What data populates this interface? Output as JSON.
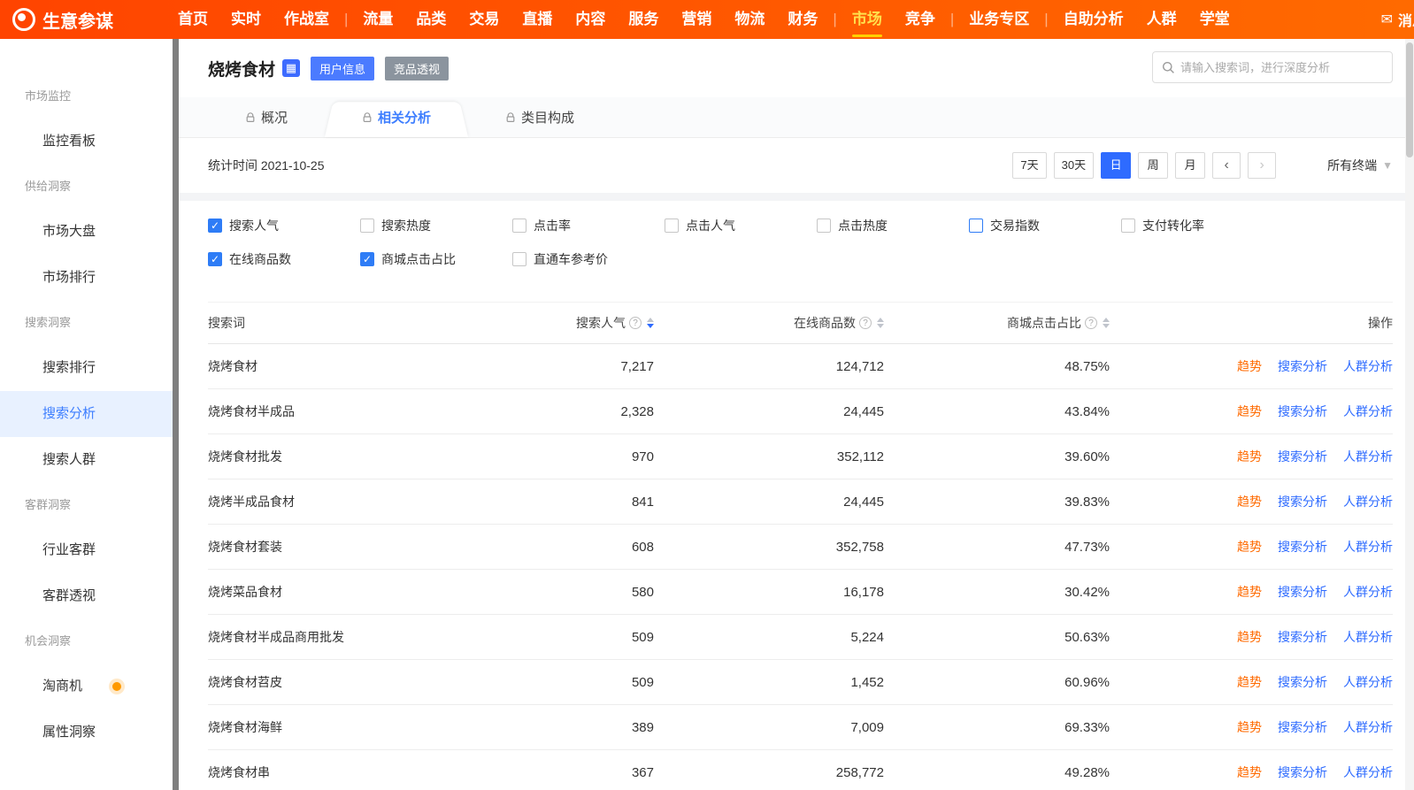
{
  "topnav": {
    "logo": "生意参谋",
    "groups": [
      [
        "首页",
        "实时",
        "作战室"
      ],
      [
        "流量",
        "品类",
        "交易",
        "直播",
        "内容",
        "服务",
        "营销",
        "物流",
        "财务"
      ],
      [
        "市场",
        "竞争"
      ],
      [
        "业务专区"
      ],
      [
        "自助分析",
        "人群",
        "学堂"
      ]
    ],
    "active": "市场",
    "message_label": "消息"
  },
  "sidebar": {
    "sections": [
      {
        "title": "市场监控",
        "items": [
          {
            "label": "监控看板"
          }
        ]
      },
      {
        "title": "供给洞察",
        "items": [
          {
            "label": "市场大盘"
          },
          {
            "label": "市场排行"
          }
        ]
      },
      {
        "title": "搜索洞察",
        "items": [
          {
            "label": "搜索排行"
          },
          {
            "label": "搜索分析",
            "active": true
          },
          {
            "label": "搜索人群"
          }
        ]
      },
      {
        "title": "客群洞察",
        "items": [
          {
            "label": "行业客群"
          },
          {
            "label": "客群透视"
          }
        ]
      },
      {
        "title": "机会洞察",
        "items": [
          {
            "label": "淘商机",
            "badge": true
          },
          {
            "label": "属性洞察"
          }
        ]
      }
    ]
  },
  "header": {
    "title": "烧烤食材",
    "title_icon": "▦",
    "buttons": [
      {
        "label": "用户信息",
        "style": "blue"
      },
      {
        "label": "竞品透视",
        "style": "gray"
      }
    ],
    "search_placeholder": "请输入搜索词，进行深度分析"
  },
  "tabs": [
    {
      "label": "概况",
      "active": false
    },
    {
      "label": "相关分析",
      "active": true
    },
    {
      "label": "类目构成",
      "active": false
    }
  ],
  "toolbar": {
    "stat_time": "统计时间 2021-10-25",
    "range_buttons": [
      "7天",
      "30天",
      "日",
      "周",
      "月"
    ],
    "active_range": "日",
    "prev": "‹",
    "next": "›",
    "terminal": "所有终端"
  },
  "filters": {
    "row1": [
      {
        "label": "搜索人气",
        "checked": true
      },
      {
        "label": "搜索热度",
        "checked": false
      },
      {
        "label": "点击率",
        "checked": false
      },
      {
        "label": "点击人气",
        "checked": false
      },
      {
        "label": "点击热度",
        "checked": false
      },
      {
        "label": "交易指数",
        "checked": false,
        "focus": true
      },
      {
        "label": "支付转化率",
        "checked": false
      }
    ],
    "row2": [
      {
        "label": "在线商品数",
        "checked": true
      },
      {
        "label": "商城点击占比",
        "checked": true
      },
      {
        "label": "直通车参考价",
        "checked": false
      }
    ]
  },
  "table": {
    "columns": [
      "搜索词",
      "搜索人气",
      "在线商品数",
      "商城点击占比",
      "操作"
    ],
    "actions": [
      "趋势",
      "搜索分析",
      "人群分析"
    ],
    "rows": [
      {
        "keyword": "烧烤食材",
        "search_popularity": "7,217",
        "online_products": "124,712",
        "mall_click_ratio": "48.75%"
      },
      {
        "keyword": "烧烤食材半成品",
        "search_popularity": "2,328",
        "online_products": "24,445",
        "mall_click_ratio": "43.84%"
      },
      {
        "keyword": "烧烤食材批发",
        "search_popularity": "970",
        "online_products": "352,112",
        "mall_click_ratio": "39.60%"
      },
      {
        "keyword": "烧烤半成品食材",
        "search_popularity": "841",
        "online_products": "24,445",
        "mall_click_ratio": "39.83%"
      },
      {
        "keyword": "烧烤食材套装",
        "search_popularity": "608",
        "online_products": "352,758",
        "mall_click_ratio": "47.73%"
      },
      {
        "keyword": "烧烤菜品食材",
        "search_popularity": "580",
        "online_products": "16,178",
        "mall_click_ratio": "30.42%"
      },
      {
        "keyword": "烧烤食材半成品商用批发",
        "search_popularity": "509",
        "online_products": "5,224",
        "mall_click_ratio": "50.63%"
      },
      {
        "keyword": "烧烤食材苕皮",
        "search_popularity": "509",
        "online_products": "1,452",
        "mall_click_ratio": "60.96%"
      },
      {
        "keyword": "烧烤食材海鲜",
        "search_popularity": "389",
        "online_products": "7,009",
        "mall_click_ratio": "69.33%"
      },
      {
        "keyword": "烧烤食材串",
        "search_popularity": "367",
        "online_products": "258,772",
        "mall_click_ratio": "49.28%"
      }
    ]
  }
}
